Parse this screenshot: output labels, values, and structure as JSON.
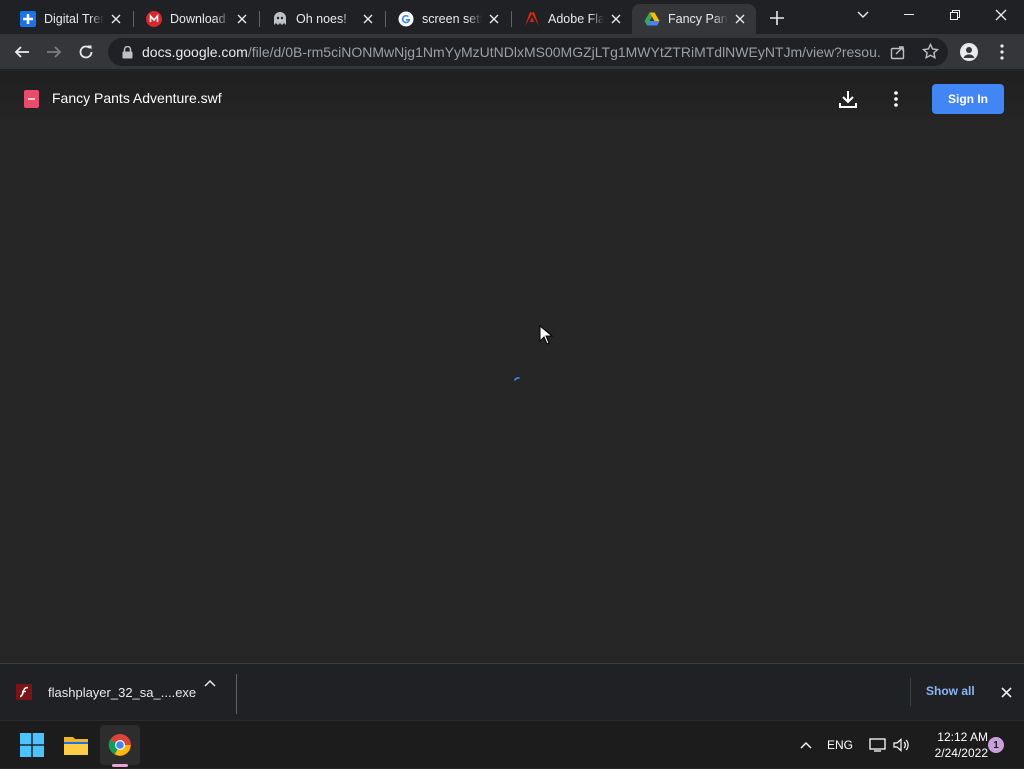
{
  "browser": {
    "tabs": [
      {
        "title": "Digital Tren",
        "icon": "digital-trends-favicon",
        "active": false
      },
      {
        "title": "Download",
        "icon": "mega-favicon",
        "active": false
      },
      {
        "title": "Oh noes!",
        "icon": "ghost-favicon",
        "active": false
      },
      {
        "title": "screen sett",
        "icon": "google-favicon",
        "active": false
      },
      {
        "title": "Adobe Flas",
        "icon": "adobe-favicon",
        "active": false
      },
      {
        "title": "Fancy Pants",
        "icon": "google-drive-favicon",
        "active": true
      }
    ],
    "url_host": "docs.google.com",
    "url_path": "/file/d/0B-rm5ciNONMwNjg1NmYyMzUtNDlxMS00MGZjLTg1MWYtZTRiMTdlNWEyNTJm/view?resou..."
  },
  "drive": {
    "file_name": "Fancy Pants Adventure.swf",
    "sign_in_label": "Sign In"
  },
  "download_shelf": {
    "file_name": "flashplayer_32_sa_....exe",
    "show_all_label": "Show all"
  },
  "taskbar": {
    "language": "ENG",
    "time": "12:12 AM",
    "date": "2/24/2022",
    "notification_count": "1"
  },
  "colors": {
    "accent_blue": "#4285f4",
    "link_blue": "#8ab4f8",
    "viewer_bg": "#262626"
  }
}
